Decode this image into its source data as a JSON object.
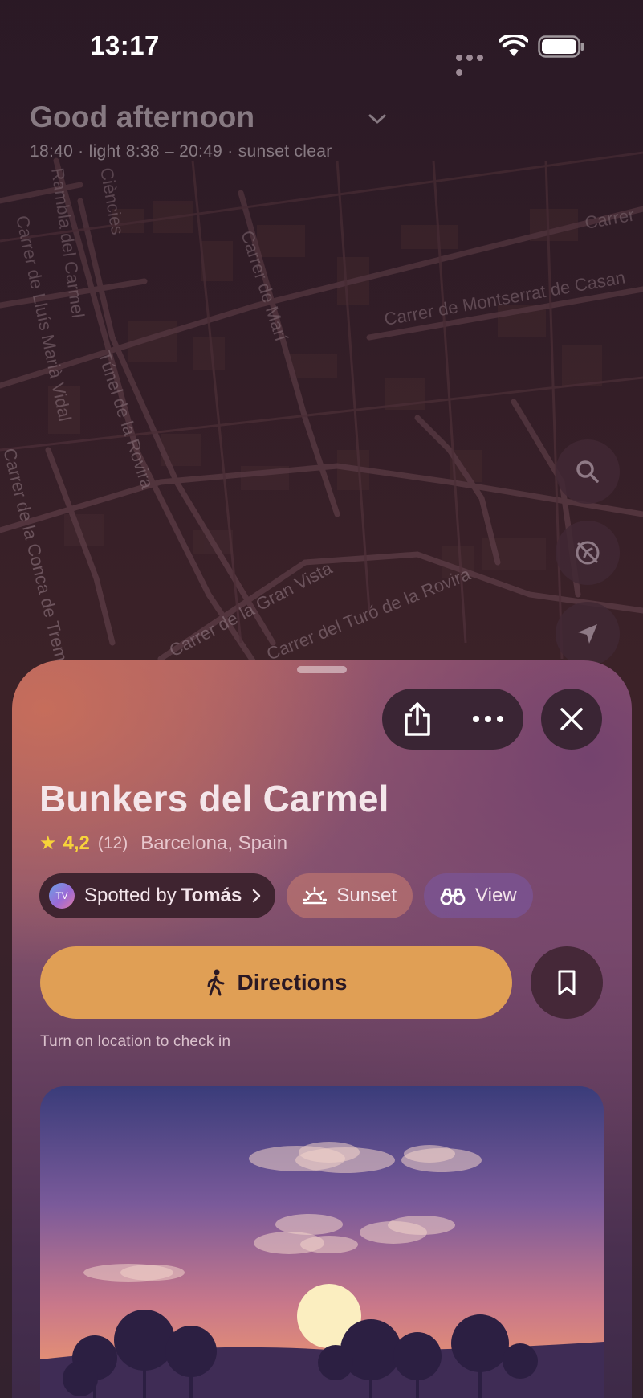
{
  "status_bar": {
    "time": "13:17"
  },
  "greeting": {
    "title": "Good afternoon",
    "subtitle": "18:40 · light 8:38 – 20:49 · sunset clear"
  },
  "map": {
    "street_labels": [
      "Rambla del Carmel",
      "Carrer de Lluís Marià Vidal",
      "Túnel de la Rovira",
      "Carrer de Marí",
      "Carrer de Montserrat de Casan",
      "Carrer de la Conca de Trem",
      "Carrer de la Gran Vista",
      "Carrer del Turó de la Rovira",
      "Carrer",
      "Ciències"
    ],
    "buttons": [
      "search-icon",
      "compass-off-icon",
      "location-arrow-icon"
    ]
  },
  "place": {
    "name": "Bunkers del Carmel",
    "rating": "4,2",
    "review_count": "(12)",
    "location": "Barcelona, Spain",
    "spotted_avatar": "TV",
    "spotted_prefix": "Spotted by",
    "spotted_name": "Tomás",
    "tag_sunset": "Sunset",
    "tag_view": "View",
    "directions_label": "Directions",
    "hint": "Turn on location to check in"
  },
  "colors": {
    "accent": "#e09f55",
    "star": "#f7d33a",
    "sheet_dark": "#3a2534"
  }
}
